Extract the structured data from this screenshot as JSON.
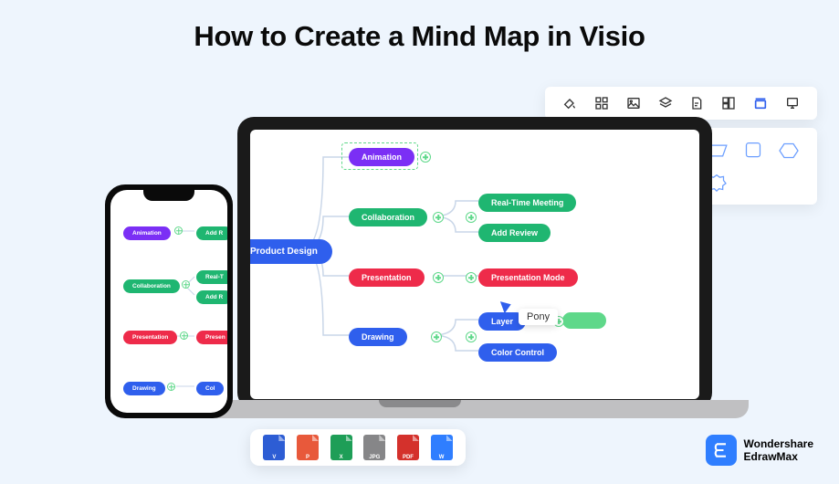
{
  "title": "How to Create a Mind Map in Visio",
  "mindmap": {
    "root": "Product Design",
    "branches": {
      "animation": "Animation",
      "collaboration": "Collaboration",
      "presentation": "Presentation",
      "drawing": "Drawing"
    },
    "leaves": {
      "realtime": "Real-Time Meeting",
      "addreview": "Add Review",
      "presmode": "Presentation Mode",
      "layer": "Layer",
      "colorcontrol": "Color Control"
    }
  },
  "phone_map": {
    "animation": "Animation",
    "collaboration": "Collaboration",
    "presentation": "Presentation",
    "drawing": "Drawing",
    "add": "Add R",
    "real": "Real-T",
    "pres": "Presen",
    "col": "Col"
  },
  "cursor_label": "Pony",
  "formats": [
    "V",
    "P",
    "X",
    "JPG",
    "PDF",
    "W"
  ],
  "brand": {
    "top": "Wondershare",
    "bottom": "EdrawMax"
  }
}
